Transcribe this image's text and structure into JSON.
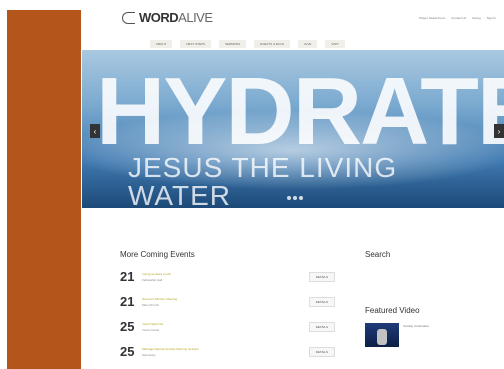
{
  "logo": {
    "bold": "WORD",
    "light": "ALIVE"
  },
  "utility_links": [
    "Prayer Needs Form",
    "Contact Us",
    "Giving",
    "Sign In"
  ],
  "nav": [
    "About",
    "Next Steps",
    "Sermons",
    "Events & Blog",
    "Give",
    "Visit"
  ],
  "hero": {
    "title": "HYDRATE",
    "subtitle": "JESUS THE LIVING WATER"
  },
  "events_title": "More Coming Events",
  "events": [
    {
      "day": "21",
      "name": "Young at Heart Lunch",
      "meta": "Fellowship Hall",
      "details": "DETAILS"
    },
    {
      "day": "21",
      "name": "Women's Ministry Meeting",
      "meta": "Main Church",
      "details": "DETAILS"
    },
    {
      "day": "25",
      "name": "Youth Night Out",
      "meta": "Youth Center",
      "details": "DETAILS"
    },
    {
      "day": "25",
      "name": "Marriage Retreat Sunday Morning Session",
      "meta": "Sanctuary",
      "details": "DETAILS"
    }
  ],
  "search": {
    "title": "Search",
    "placeholder": ""
  },
  "featured": {
    "title": "Featured Video",
    "caption": "Sunday Celebration"
  },
  "colors": {
    "sidebar": "#b4561b",
    "accent": "#d5bd1c"
  }
}
